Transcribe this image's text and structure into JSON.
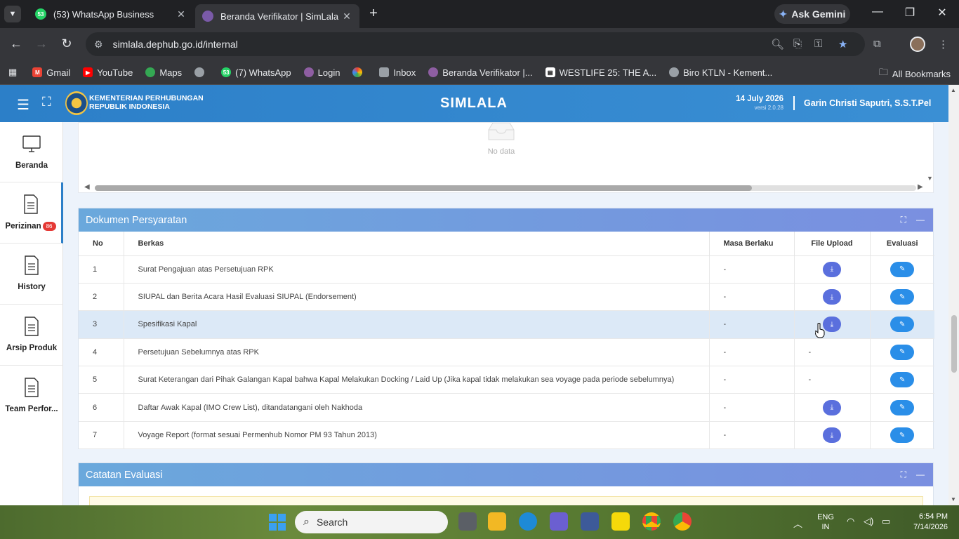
{
  "browser": {
    "tabs": [
      {
        "title": "(53) WhatsApp Business",
        "favicon_text": "53",
        "active": false
      },
      {
        "title": "Beranda Verifikator | SimLala",
        "favicon_text": "",
        "active": true
      }
    ],
    "new_tab": "+",
    "gemini_label": "Ask Gemini",
    "url": "simlala.dephub.go.id/internal",
    "bookmarks": [
      {
        "label": "Gmail",
        "color": "#ea4335"
      },
      {
        "label": "YouTube",
        "color": "#ff0000"
      },
      {
        "label": "Maps",
        "color": "#34a853"
      },
      {
        "label": "",
        "color": "#9aa0a6"
      },
      {
        "label": "(7) WhatsApp",
        "color": "#25d366",
        "text": "53"
      },
      {
        "label": "Login",
        "color": "#8e5ea2"
      },
      {
        "label": "",
        "color": "#fbbc05"
      },
      {
        "label": "Inbox",
        "color": "#9aa0a6"
      },
      {
        "label": "Beranda Verifikator |...",
        "color": "#8e5ea2"
      },
      {
        "label": "WESTLIFE 25: THE A...",
        "color": "#ffffff"
      },
      {
        "label": "Biro KTLN - Kement...",
        "color": "#9aa0a6"
      }
    ],
    "all_bookmarks": "All Bookmarks"
  },
  "header": {
    "ministry_line1": "KEMENTERIAN PERHUBUNGAN",
    "ministry_line2": "REPUBLIK INDONESIA",
    "app_title": "SIMLALA",
    "date": "14 July 2026",
    "version": "versi 2.0.28",
    "user": "Garin Christi Saputri, S.S.T.Pel"
  },
  "sidebar": {
    "items": [
      {
        "label": "Beranda"
      },
      {
        "label": "Perizinan",
        "badge": "86"
      },
      {
        "label": "History"
      },
      {
        "label": "Arsip Produk"
      },
      {
        "label": "Team Perfor..."
      }
    ]
  },
  "previous_table": {
    "empty_text": "No data"
  },
  "dokumen": {
    "title": "Dokumen Persyaratan",
    "columns": [
      "No",
      "Berkas",
      "Masa Berlaku",
      "File Upload",
      "Evaluasi"
    ],
    "rows": [
      {
        "no": "1",
        "berkas": "Surat Pengajuan atas Persetujuan RPK",
        "masa": "-",
        "file": true
      },
      {
        "no": "2",
        "berkas": "SIUPAL dan Berita Acara Hasil Evaluasi SIUPAL (Endorsement)",
        "masa": "-",
        "file": true
      },
      {
        "no": "3",
        "berkas": "Spesifikasi Kapal",
        "masa": "-",
        "file": true
      },
      {
        "no": "4",
        "berkas": "Persetujuan Sebelumnya atas RPK",
        "masa": "-",
        "file": false,
        "file_text": "-"
      },
      {
        "no": "5",
        "berkas": "Surat Keterangan dari Pihak Galangan Kapal bahwa Kapal Melakukan Docking / Laid Up (Jika kapal tidak melakukan sea voyage pada periode sebelumnya)",
        "masa": "-",
        "file": false,
        "file_text": "-"
      },
      {
        "no": "6",
        "berkas": "Daftar Awak Kapal (IMO Crew List), ditandatangani oleh Nakhoda",
        "masa": "-",
        "file": true
      },
      {
        "no": "7",
        "berkas": "Voyage Report (format sesuai Permenhub Nomor PM 93 Tahun 2013)",
        "masa": "-",
        "file": true
      }
    ]
  },
  "catatan": {
    "title": "Catatan Evaluasi"
  },
  "taskbar": {
    "search_placeholder": "Search",
    "lang1": "ENG",
    "lang2": "IN",
    "time": "6:54 PM",
    "date": "7/14/2026"
  },
  "colors": {
    "header_blue": "#2c7fc8",
    "card_head_start": "#6aa8dc",
    "card_head_end": "#7a8fe0",
    "download_button": "#5a6fdd",
    "edit_button": "#2a8ee8",
    "badge_red": "#e53935"
  }
}
